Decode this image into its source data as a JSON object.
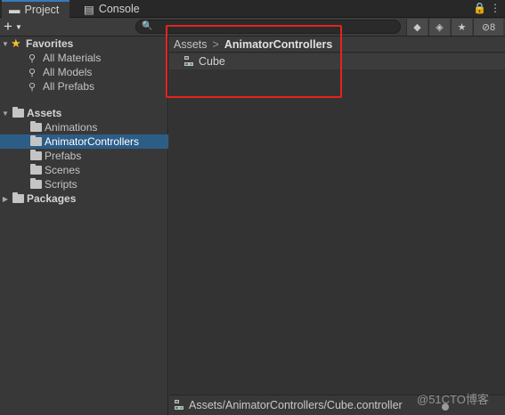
{
  "tabs": {
    "project": "Project",
    "console": "Console"
  },
  "window_controls": {
    "lock": "🔒",
    "menu": "⋮"
  },
  "toolbar": {
    "plus": "+",
    "plus_arrow": "▼",
    "search_icon": "🔍",
    "hidden_count": "8"
  },
  "tree": {
    "favorites": {
      "label": "Favorites",
      "items": [
        "All Materials",
        "All Models",
        "All Prefabs"
      ]
    },
    "assets": {
      "label": "Assets",
      "items": [
        "Animations",
        "AnimatorControllers",
        "Prefabs",
        "Scenes",
        "Scripts"
      ],
      "selected": "AnimatorControllers"
    },
    "packages": {
      "label": "Packages"
    }
  },
  "breadcrumb": {
    "root": "Assets",
    "separator": ">",
    "current": "AnimatorControllers"
  },
  "assets_list": [
    {
      "name": "Cube",
      "icon": "animator-controller-icon"
    }
  ],
  "statusbar": {
    "path": "Assets/AnimatorControllers/Cube.controller"
  },
  "watermark": "@51CTO博客",
  "colors": {
    "accent_tab": "#3a79bb",
    "selection": "#2c5d87",
    "highlight_box": "#e5231f",
    "favorite_star": "#f2c02b"
  }
}
